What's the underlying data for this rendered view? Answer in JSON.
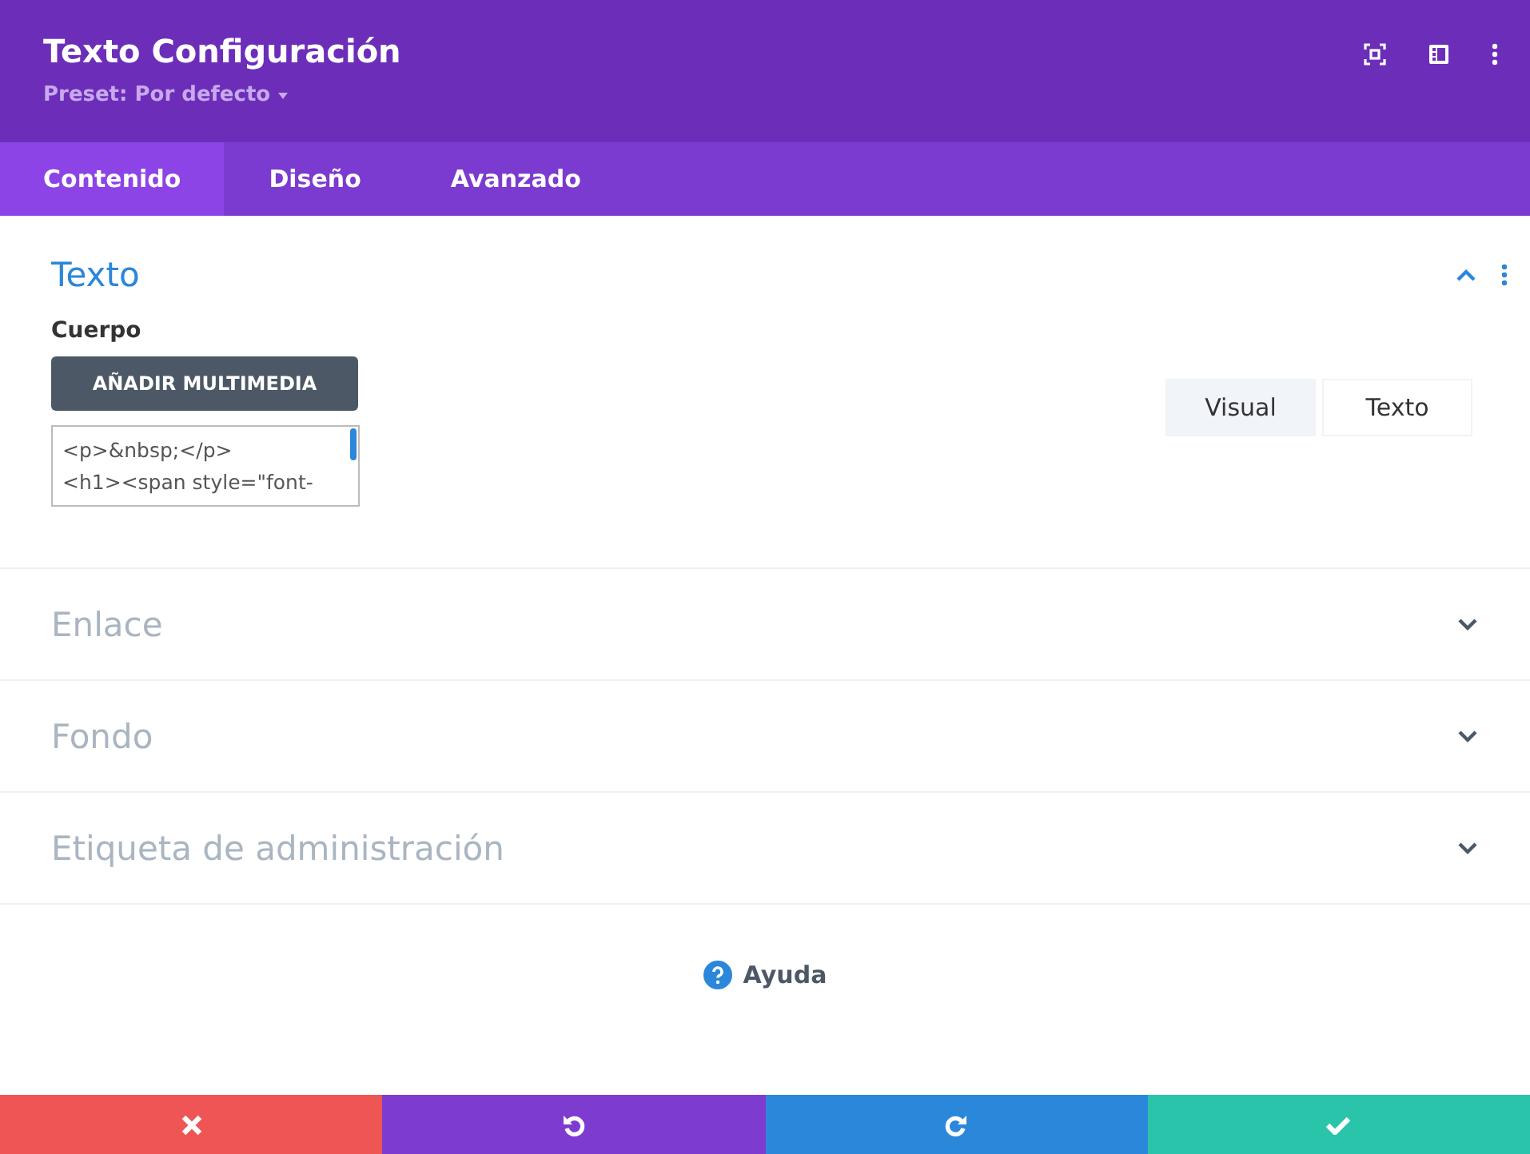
{
  "header": {
    "title": "Texto Configuración",
    "preset": "Preset: Por defecto"
  },
  "tabs": [
    {
      "label": "Contenido",
      "selected": true
    },
    {
      "label": "Diseño",
      "selected": false
    },
    {
      "label": "Avanzado",
      "selected": false
    }
  ],
  "sections": [
    {
      "title": "Texto",
      "expanded": true,
      "field_label": "Cuerpo",
      "media_button": "AÑADIR MULTIMEDIA",
      "editor_lines": [
        "<p>&nbsp;</p>",
        "<h1><span style=\"font-"
      ],
      "editor_modes": [
        {
          "label": "Visual",
          "selected": true
        },
        {
          "label": "Texto",
          "selected": false
        }
      ]
    },
    {
      "title": "Enlace",
      "expanded": false
    },
    {
      "title": "Fondo",
      "expanded": false
    },
    {
      "title": "Etiqueta de administración",
      "expanded": false
    }
  ],
  "help": "Ayuda",
  "footer_buttons": [
    {
      "kind": "discard"
    },
    {
      "kind": "undo"
    },
    {
      "kind": "redo"
    },
    {
      "kind": "save"
    }
  ]
}
